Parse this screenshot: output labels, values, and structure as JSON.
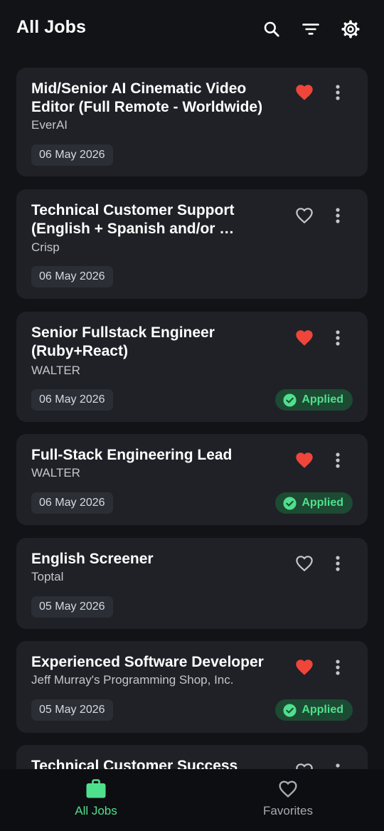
{
  "app": {
    "title": "All Jobs"
  },
  "colors": {
    "background": "#121316",
    "card": "#1f2127",
    "favorite_active": "#f0453a",
    "applied_green": "#4fe08e",
    "applied_bg": "#1d4a32",
    "nav_active": "#4fe08e"
  },
  "icons": {
    "search": "search-icon",
    "filter": "filter-icon",
    "settings": "gear-icon",
    "favorite": "heart-icon",
    "more": "more-vertical-icon",
    "applied": "check-circle-icon",
    "all_jobs": "briefcase-icon",
    "favorites": "heart-outline-icon"
  },
  "jobs": [
    {
      "title": "Mid/Senior AI Cinematic Video Editor (Full Remote - Worldwide)",
      "company": "EverAI",
      "date": "06 May 2026",
      "favorite": true,
      "applied": false
    },
    {
      "title": "Technical Customer Support (English + Spanish and/or …",
      "company": "Crisp",
      "date": "06 May 2026",
      "favorite": false,
      "applied": false
    },
    {
      "title": "Senior Fullstack Engineer (Ruby+React)",
      "company": "WALTER",
      "date": "06 May 2026",
      "favorite": true,
      "applied": true,
      "applied_label": "Applied"
    },
    {
      "title": "Full-Stack Engineering Lead",
      "company": "WALTER",
      "date": "06 May 2026",
      "favorite": true,
      "applied": true,
      "applied_label": "Applied"
    },
    {
      "title": "English Screener",
      "company": "Toptal",
      "date": "05 May 2026",
      "favorite": false,
      "applied": false
    },
    {
      "title": "Experienced Software Developer",
      "company": "Jeff Murray's Programming Shop, Inc.",
      "date": "05 May 2026",
      "favorite": true,
      "applied": true,
      "applied_label": "Applied"
    },
    {
      "title": "Technical Customer Success",
      "favorite": false,
      "applied": false
    }
  ],
  "bottom_nav": {
    "items": [
      {
        "label": "All Jobs",
        "active": true
      },
      {
        "label": "Favorites",
        "active": false
      }
    ]
  }
}
